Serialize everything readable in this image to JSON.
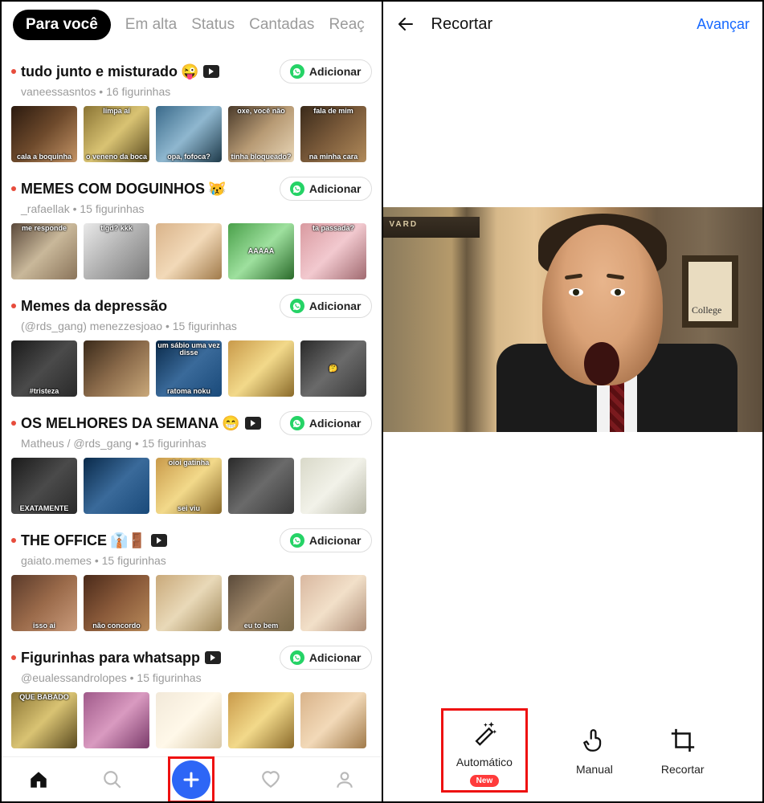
{
  "left": {
    "tabs": [
      "Para você",
      "Em alta",
      "Status",
      "Cantadas",
      "Reaç"
    ],
    "active_tab_index": 0,
    "add_button_label": "Adicionar",
    "packs": [
      {
        "title": "tudo junto e misturado",
        "emoji": "😜",
        "animated": true,
        "subtitle": "vaneessasntos • 16 figurinhas",
        "thumbs": [
          {
            "caption_bottom": "cala a boquinha",
            "palette": "p1"
          },
          {
            "caption_top": "limpa aí",
            "caption_bottom": "o veneno da boca",
            "palette": "p2"
          },
          {
            "caption_bottom": "opa, fofoca?",
            "palette": "p3"
          },
          {
            "caption_top": "oxe, você não",
            "caption_bottom": "tinha bloqueado?",
            "palette": "p4"
          },
          {
            "caption_top": "fala de mim",
            "caption_bottom": "na minha cara",
            "palette": "p5"
          }
        ]
      },
      {
        "title": "MEMES COM DOGUINHOS",
        "emoji": "😿",
        "animated": false,
        "subtitle": "_rafaellak • 15 figurinhas",
        "thumbs": [
          {
            "caption_top": "me responde",
            "palette": "p6"
          },
          {
            "caption_top": "tlgd? kkk",
            "palette": "p7"
          },
          {
            "palette": "p8"
          },
          {
            "caption_mid": "AAAAA",
            "palette": "p9"
          },
          {
            "caption_top": "ta passada?",
            "palette": "p10"
          }
        ]
      },
      {
        "title": "Memes da depressão",
        "emoji": "",
        "animated": false,
        "subtitle": "(@rds_gang) menezzesjoao • 15 figurinhas",
        "thumbs": [
          {
            "caption_bottom": "#tristeza",
            "palette": "p11"
          },
          {
            "palette": "p12"
          },
          {
            "caption_top": "um sábio uma vez disse",
            "caption_bottom": "ratoma noku",
            "palette": "p13"
          },
          {
            "palette": "p14"
          },
          {
            "caption_mid": "🤔",
            "palette": "p15"
          }
        ]
      },
      {
        "title": "OS MELHORES DA SEMANA",
        "emoji": "😁",
        "animated": true,
        "subtitle": "Matheus / @rds_gang • 15 figurinhas",
        "thumbs": [
          {
            "caption_bottom": "EXATAMENTE",
            "palette": "p11"
          },
          {
            "palette": "p13"
          },
          {
            "caption_top": "oioi gatinha",
            "caption_bottom": "sei viu",
            "palette": "p14"
          },
          {
            "palette": "p15"
          },
          {
            "palette": "p16"
          }
        ]
      },
      {
        "title": "THE OFFICE",
        "emoji": "👔🚪",
        "animated": true,
        "subtitle": "gaiato.memes • 15 figurinhas",
        "thumbs": [
          {
            "caption_bottom": "isso ai",
            "palette": "p18"
          },
          {
            "caption_bottom": "não concordo",
            "palette": "p19"
          },
          {
            "palette": "p22"
          },
          {
            "caption_bottom": "eu to bem",
            "palette": "p23"
          },
          {
            "palette": "p24"
          }
        ]
      },
      {
        "title": "Figurinhas para whatsapp",
        "emoji": "",
        "animated": true,
        "subtitle": "@eualessandrolopes • 15 figurinhas",
        "thumbs": [
          {
            "caption_top": "QUE BABADO",
            "palette": "p2"
          },
          {
            "palette": "p26"
          },
          {
            "palette": "p17"
          },
          {
            "palette": "p14"
          },
          {
            "palette": "p8"
          }
        ]
      }
    ]
  },
  "right": {
    "title": "Recortar",
    "advance_label": "Avançar",
    "frame_text": "VARD",
    "tools": [
      {
        "label": "Automático",
        "icon": "magic-wand-icon",
        "new_badge": "New",
        "highlighted": true
      },
      {
        "label": "Manual",
        "icon": "touch-icon"
      },
      {
        "label": "Recortar",
        "icon": "crop-icon"
      }
    ]
  }
}
